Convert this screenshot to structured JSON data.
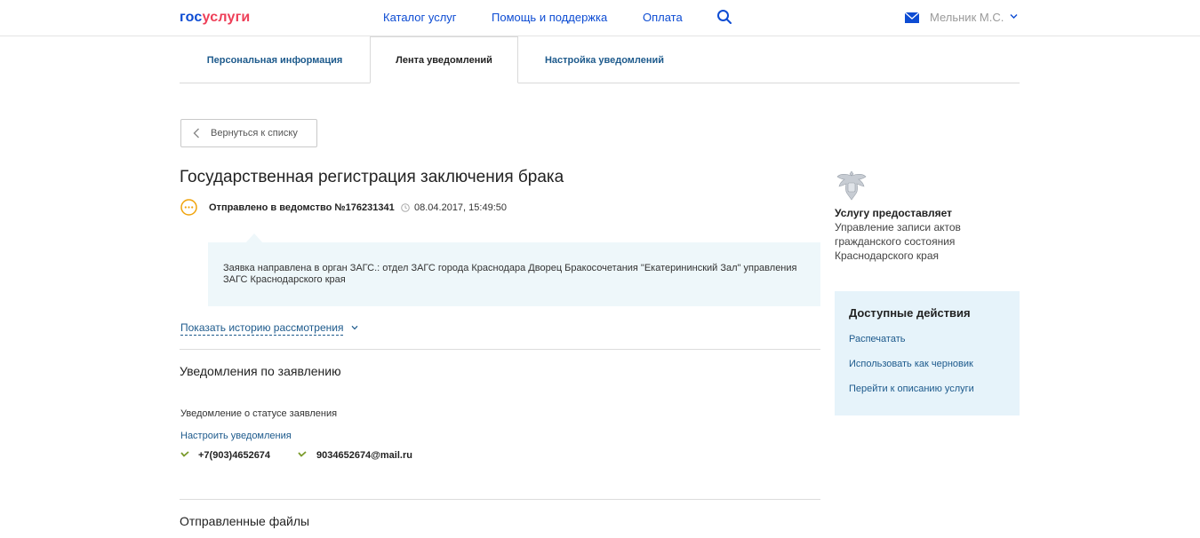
{
  "header": {
    "logo_part1": "гос",
    "logo_part2": "услуги",
    "nav": [
      "Каталог услуг",
      "Помощь и поддержка",
      "Оплата"
    ],
    "user_name": "Мельник М.С."
  },
  "tabs": [
    {
      "label": "Персональная информация",
      "active": false
    },
    {
      "label": "Лента уведомлений",
      "active": true
    },
    {
      "label": "Настройка уведомлений",
      "active": false
    }
  ],
  "back_button": "Вернуться к списку",
  "page_title": "Государственная регистрация заключения брака",
  "status": {
    "text": "Отправлено в ведомство №176231341",
    "datetime": "08.04.2017, 15:49:50",
    "message_line1": "Заявка направлена в орган ЗАГС.: отдел ЗАГС города Краснодара Дворец Бракосочетания \"Екатерининский Зал\" управления",
    "message_line2": "ЗАГС Краснодарского края"
  },
  "history_link": "Показать историю рассмотрения",
  "notifications": {
    "title": "Уведомления по заявлению",
    "status_label": "Уведомление о статусе заявления",
    "settings_link": "Настроить уведомления",
    "phone": "+7(903)4652674",
    "email": "9034652674@mail.ru"
  },
  "files": {
    "title": "Отправленные файлы"
  },
  "provider": {
    "heading": "Услугу предоставляет",
    "lines": [
      "Управление записи актов",
      "гражданского состояния",
      "Краснодарского края"
    ]
  },
  "actions": {
    "title": "Доступные действия",
    "items": [
      "Распечатать",
      "Использовать как черновик",
      "Перейти к описанию услуги"
    ]
  },
  "colors": {
    "brand_blue": "#0d4cd3",
    "brand_red": "#ee3f58",
    "link": "#1d5a8c",
    "status_orange": "#f0a30a",
    "check_green": "#7a9a2a"
  }
}
